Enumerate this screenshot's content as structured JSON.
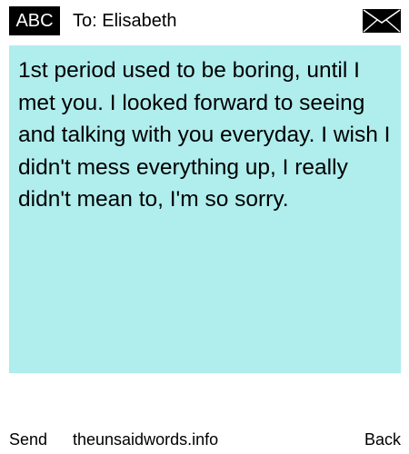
{
  "header": {
    "mode_label": "ABC",
    "recipient": "To: Elisabeth",
    "mail_icon": "envelope-icon"
  },
  "message": {
    "body": "1st period used to be boring, until I met you. I looked forward to seeing and talking with you everyday. I wish I didn't mess everything up, I really didn't mean to, I'm so sorry."
  },
  "footer": {
    "send_label": "Send",
    "site_label": "theunsaidwords.info",
    "back_label": "Back"
  },
  "colors": {
    "message_background": "#b0eded",
    "badge_background": "#000000",
    "text": "#000000"
  }
}
